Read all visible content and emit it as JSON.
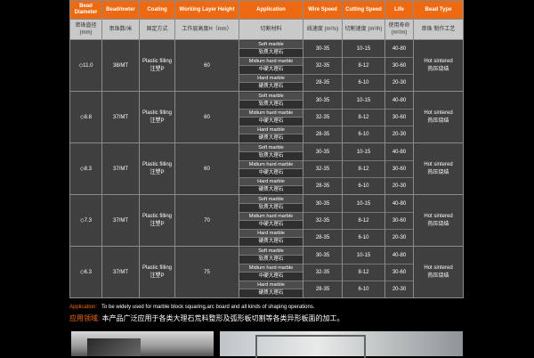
{
  "headers": [
    "Bead Diameter",
    "Bead/meter",
    "Coating",
    "Working Layer Height",
    "Application",
    "Wire Speed",
    "Cutting Speed",
    "Life",
    "Bead Type"
  ],
  "headers_cn": [
    "串珠直径 (mm)",
    "串珠数/米",
    "固定方式",
    "工作层高度H（mm）",
    "切割材料",
    "线速度 (m²/s)",
    "切割速度 (m²/h)",
    "使用寿命 (m²/m)",
    "串珠   制作工艺"
  ],
  "rows": [
    {
      "diameter": "◇11.0",
      "bead_meter": "38/MT",
      "coating_en": "Plastic filling",
      "coating_cn": "注塑P",
      "height": "60",
      "bead_type_en": "Hot sintered",
      "bead_type_cn": "热压烧结"
    },
    {
      "diameter": "◇8.8",
      "bead_meter": "37/MT",
      "coating_en": "Plastic filling",
      "coating_cn": "注塑P",
      "height": "60",
      "bead_type_en": "Hot sintered",
      "bead_type_cn": "热压烧结"
    },
    {
      "diameter": "◇8.3",
      "bead_meter": "37/MT",
      "coating_en": "Plastic filling",
      "coating_cn": "注塑P",
      "height": "60",
      "bead_type_en": "Hot sintered",
      "bead_type_cn": "热压烧结"
    },
    {
      "diameter": "◇7.3",
      "bead_meter": "37/MT",
      "coating_en": "Plastic filling",
      "coating_cn": "注塑P",
      "height": "70",
      "bead_type_en": "Hot sintered",
      "bead_type_cn": "热压烧结"
    },
    {
      "diameter": "◇6.3",
      "bead_meter": "37/MT",
      "coating_en": "Plastic filling",
      "coating_cn": "注塑P",
      "height": "75",
      "bead_type_en": "Hot sintered",
      "bead_type_cn": "热压烧结"
    }
  ],
  "application_list": [
    {
      "en": "Soft marble",
      "cn": "软质大理石",
      "wire_speed": "30-35",
      "cutting_speed": "10-15",
      "life": "40-80"
    },
    {
      "en": "Midium hard marble",
      "cn": "中硬大理石",
      "wire_speed": "32-35",
      "cutting_speed": "8-12",
      "life": "30-60"
    },
    {
      "en": "Hard marble",
      "cn": "硬质大理石",
      "wire_speed": "28-35",
      "cutting_speed": "6-10",
      "life": "20-30"
    }
  ],
  "application_note": {
    "label_en": "Application:",
    "text_en": "To be widely used for marble block squaring,arc board and all kinds of shaping operations.",
    "label_cn": "应用领域:",
    "text_cn": "本产品广泛应用于各类大理石荒料整形及弧形板切割等各类异形板面的加工。"
  }
}
